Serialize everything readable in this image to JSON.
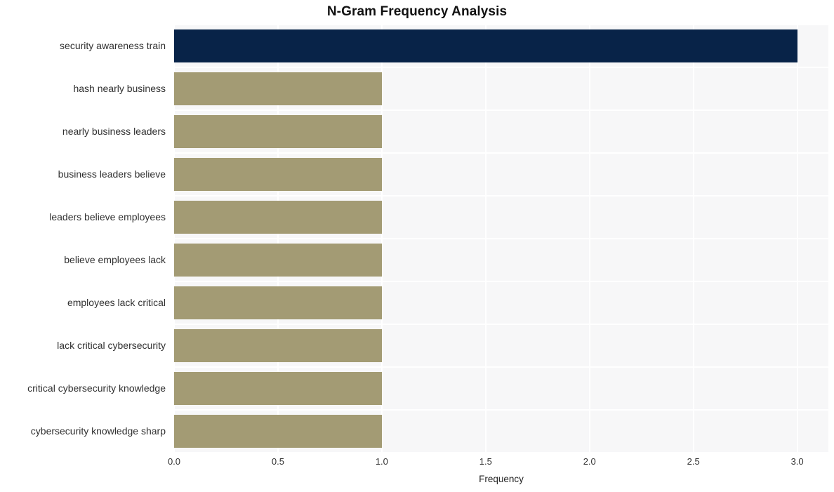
{
  "chart_data": {
    "type": "bar",
    "orientation": "horizontal",
    "title": "N-Gram Frequency Analysis",
    "xlabel": "Frequency",
    "ylabel": "",
    "xlim": [
      0.0,
      3.15
    ],
    "xticks": [
      "0.0",
      "0.5",
      "1.0",
      "1.5",
      "2.0",
      "2.5",
      "3.0"
    ],
    "xtick_values": [
      0.0,
      0.5,
      1.0,
      1.5,
      2.0,
      2.5,
      3.0
    ],
    "grid": true,
    "grid_axis": "both",
    "legend": "none",
    "categories": [
      "security awareness train",
      "hash nearly business",
      "nearly business leaders",
      "business leaders believe",
      "leaders believe employees",
      "believe employees lack",
      "employees lack critical",
      "lack critical cybersecurity",
      "critical cybersecurity knowledge",
      "cybersecurity knowledge sharp"
    ],
    "values": [
      3,
      1,
      1,
      1,
      1,
      1,
      1,
      1,
      1,
      1
    ],
    "bar_colors": [
      "#082348",
      "#a39b74",
      "#a39b74",
      "#a39b74",
      "#a39b74",
      "#a39b74",
      "#a39b74",
      "#a39b74",
      "#a39b74",
      "#a39b74"
    ],
    "colors": {
      "highlight_bar": "#082348",
      "default_bar": "#a39b74",
      "plot_background": "#f7f7f8",
      "figure_background": "#ffffff",
      "gridline": "#ffffff",
      "text": "#303030",
      "title": "#111111"
    }
  }
}
